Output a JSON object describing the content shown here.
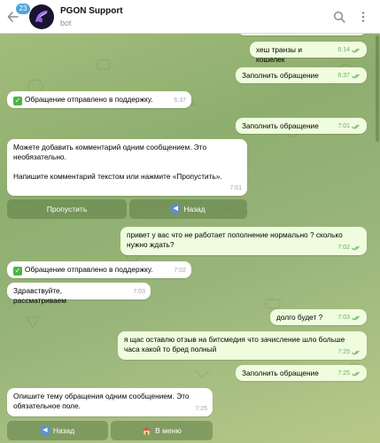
{
  "header": {
    "unread_count": "23",
    "title": "PGON Support",
    "subtitle": "bot"
  },
  "messages": [
    {
      "id": "m1",
      "dir": "out",
      "text": "хеш транзы и кошелек",
      "time": "6:14",
      "read": true
    },
    {
      "id": "m2",
      "dir": "out",
      "text": "Заполнить обращение",
      "time": "6:37",
      "read": true
    },
    {
      "id": "m3",
      "dir": "in",
      "text": "Обращение отправлено в поддержку.",
      "time": "6:37",
      "check": true
    },
    {
      "id": "m4",
      "dir": "out",
      "text": "Заполнить обращение",
      "time": "7:01",
      "read": true
    },
    {
      "id": "m5",
      "dir": "in",
      "text_lines": [
        "Можете добавить комментарий одним сообщением. Это",
        "необязательно.",
        "",
        "Напишите комментарий текстом или нажмите «Пропустить»."
      ],
      "time": "7:01"
    },
    {
      "id": "m6",
      "dir": "out",
      "text_lines": [
        "привет у вас что не работает пополнение нормально ? сколько",
        "нужно ждать?"
      ],
      "time": "7:02",
      "read": true
    },
    {
      "id": "m7",
      "dir": "in",
      "text": "Обращение отправлено в поддержку.",
      "time": "7:02",
      "check": true
    },
    {
      "id": "m8",
      "dir": "in",
      "text": "Здравствуйте, рассматриваем",
      "time": "7:03"
    },
    {
      "id": "m9",
      "dir": "out",
      "text": "долго будет ?",
      "time": "7:03",
      "read": true
    },
    {
      "id": "m10",
      "dir": "out",
      "text_lines": [
        "я щас оставлю отзыв на битсмедия что зачисление шло больше",
        "часа какой то бред полный"
      ],
      "time": "7:25",
      "read": true
    },
    {
      "id": "m11",
      "dir": "out",
      "text": "Заполнить обращение",
      "time": "7:25",
      "read": true
    },
    {
      "id": "m12",
      "dir": "in",
      "text_lines": [
        "Опишите тему обращения одним сообщением. Это",
        "обязательное поле."
      ],
      "time": "7:25"
    }
  ],
  "keyboard_1": {
    "skip": "Пропустить",
    "back": "Назад"
  },
  "keyboard_2": {
    "back": "Назад",
    "menu": "В меню"
  },
  "colors": {
    "incoming": "#ffffff",
    "outgoing": "#effdde",
    "badge": "#4fa3e0",
    "check_green": "#4bb543"
  }
}
